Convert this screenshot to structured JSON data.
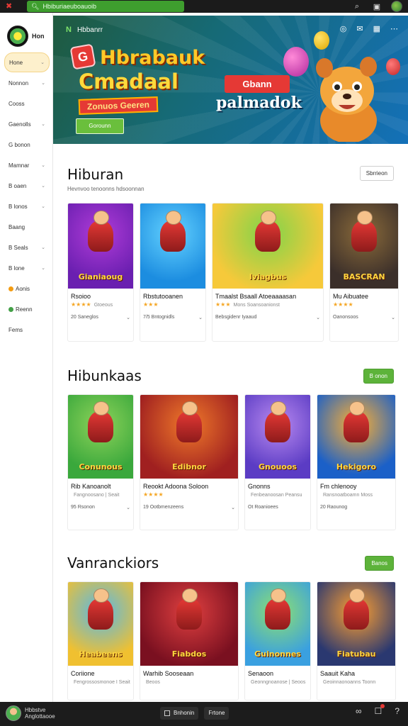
{
  "topbar": {
    "url_text": "Hbiburiaeuboauoib",
    "icons": [
      "app-logo-icon",
      "search-icon",
      "window-icon",
      "profile-avatar"
    ]
  },
  "sidebar": {
    "brand_name": "Hon",
    "items": [
      {
        "label": "Hone",
        "active": true,
        "chevron": true
      },
      {
        "label": "Nonnon",
        "chevron": true
      },
      {
        "label": "Cooss",
        "chevron": false
      },
      {
        "label": "Gaenolls",
        "chevron": true
      },
      {
        "label": "G bonon",
        "chevron": false
      },
      {
        "label": "Mamnar",
        "chevron": true
      },
      {
        "label": "B oaen",
        "chevron": true
      },
      {
        "label": "B lonos",
        "chevron": true
      },
      {
        "label": "Baang",
        "chevron": false
      },
      {
        "label": "B Seals",
        "chevron": true
      },
      {
        "label": "B lone",
        "chevron": true
      },
      {
        "label": "Aonis",
        "chevron": false,
        "dot": "#f39c12"
      },
      {
        "label": "Reenn",
        "chevron": false,
        "dot": "#43a047"
      },
      {
        "label": "Fems",
        "chevron": false
      }
    ]
  },
  "hero": {
    "brand": "Hbbanrr",
    "title_line1": "Hbrabauk",
    "title_line2": "Cmadaal",
    "tag": "Zonuos Geeren",
    "cta": "Gorounn",
    "mid_button": "Gbann",
    "mid_title": "palmadok",
    "badge": "G"
  },
  "sections": [
    {
      "title": "Hiburan",
      "subtitle": "Hevnvoo tenoonns hdsoonnan",
      "button": "Sbrrieon",
      "button_style": "outline",
      "cards": [
        {
          "art": "Gianiaoug",
          "name": "Rsoioo",
          "stars": "★★★★",
          "rating_label": "Gtoeous",
          "meta_left": "20 Saneglos",
          "meta_right": "⌄"
        },
        {
          "art": "",
          "name": "Rbstutooanen",
          "stars": "★★★",
          "rating_label": "",
          "meta_left": "7/5 Bntognidls",
          "meta_right": "⌄"
        },
        {
          "art": "Iviagbus",
          "name": "Tmaalst Bsaall Atoeaaaasan",
          "stars": "★★★",
          "rating_label": "Mons Soansoanionst",
          "meta_left": "Bebsgidenr Iyaaud",
          "meta_right": "⌄"
        },
        {
          "art": "BASCRAN",
          "name": "Mu Aibuatee",
          "stars": "★★★★",
          "rating_label": "",
          "meta_left": "Oanonsoos",
          "meta_right": "⌄"
        }
      ]
    },
    {
      "title": "Hibunkaas",
      "subtitle": "",
      "button": "B onon",
      "button_style": "green",
      "cards": [
        {
          "art": "Conunous",
          "name": "Rib Kanoanolt",
          "stars": "",
          "rating_label": "Fangnoosano | Seait",
          "meta_left": "95 Rsonon",
          "meta_right": "⌄"
        },
        {
          "art": "Edibnor",
          "name": "Reookt Adoona Soloon",
          "stars": "★★★★",
          "rating_label": "",
          "meta_left": "19 Ootbmenzeens",
          "meta_right": "⌄"
        },
        {
          "art": "Gnouoos",
          "name": "Gnonns",
          "stars": "",
          "rating_label": "Fenbeanoosan Peansu",
          "meta_left": "Ot Roanioees",
          "meta_right": ""
        },
        {
          "art": "Hekigoro",
          "name": "Fm chlenooy",
          "stars": "",
          "rating_label": "Ransnoatboamn Moss",
          "meta_left": "20 Raounog",
          "meta_right": ""
        }
      ]
    },
    {
      "title": "Vanranckiors",
      "subtitle": "",
      "button": "Banos",
      "button_style": "green",
      "cards": [
        {
          "art": "Heabeens",
          "name": "Coriione",
          "stars": "",
          "rating_label": "Fengrossosmonoe I Seait",
          "meta_left": "",
          "meta_right": ""
        },
        {
          "art": "Fiabdos",
          "name": "Warhib Sooseaan",
          "stars": "",
          "rating_label": "Beoos",
          "meta_left": "",
          "meta_right": ""
        },
        {
          "art": "Guinonnes",
          "name": "Senaoon",
          "stars": "",
          "rating_label": "Geonngnoanose | Seoos",
          "meta_left": "",
          "meta_right": ""
        },
        {
          "art": "Fiatubau",
          "name": "Saauit Kaha",
          "stars": "",
          "rating_label": "Geoinnaonoanns Toonn",
          "meta_left": "",
          "meta_right": ""
        }
      ]
    }
  ],
  "bottombar": {
    "user_line1": "Hbbstve",
    "user_line2": "Anglottaooe",
    "center_chip1": "Bnhonin",
    "center_chip2": "Frtone",
    "icons": [
      "link-icon",
      "chat-icon",
      "help-icon"
    ]
  }
}
